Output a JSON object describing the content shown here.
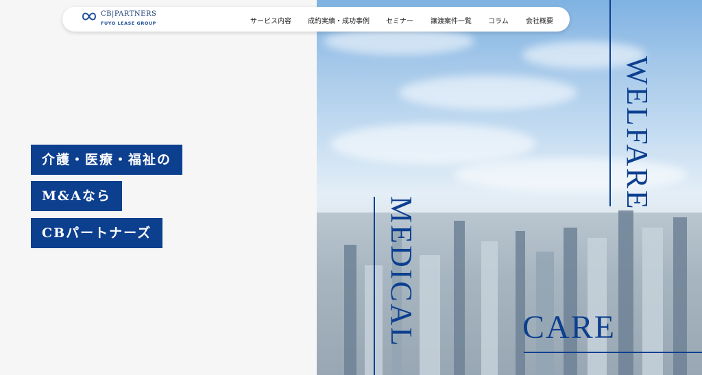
{
  "brand": {
    "name": "CB|PARTNERS",
    "sub": "FUYO LEASE GROUP",
    "color": "#1c3d73"
  },
  "nav": {
    "items": [
      {
        "label": "サービス内容"
      },
      {
        "label": "成約実績・成功事例"
      },
      {
        "label": "セミナー"
      },
      {
        "label": "譲渡案件一覧"
      },
      {
        "label": "コラム"
      },
      {
        "label": "会社概要"
      }
    ]
  },
  "hero": {
    "lines": [
      "介護・医療・福祉の",
      "M&Aなら",
      "CBパートナーズ"
    ],
    "words": {
      "welfare": "WELFARE",
      "medical": "MEDICAL",
      "care": "CARE"
    },
    "accent_color": "#0d3f8f"
  }
}
